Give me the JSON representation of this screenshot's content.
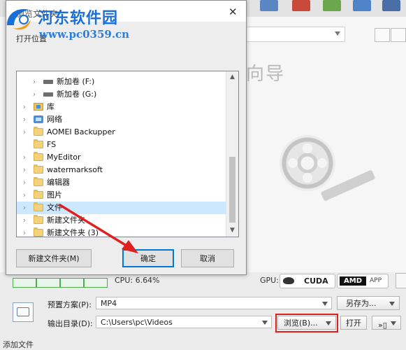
{
  "watermark": {
    "title": "河东软件园",
    "url": "www.pc0359.cn"
  },
  "dialog": {
    "title": "浏览文件夹",
    "prompt": "打开位置",
    "tree": [
      {
        "label": "新加卷 (F:)",
        "icon": "drive-icon",
        "indent": 1,
        "expander": true
      },
      {
        "label": "新加卷 (G:)",
        "icon": "drive-icon",
        "indent": 1,
        "expander": true
      },
      {
        "label": "库",
        "icon": "library-icon",
        "indent": 0,
        "expander": true
      },
      {
        "label": "网络",
        "icon": "network-icon",
        "indent": 0,
        "expander": true
      },
      {
        "label": "AOMEI Backupper",
        "icon": "folder-icon",
        "indent": 0,
        "expander": true
      },
      {
        "label": "FS",
        "icon": "folder-icon",
        "indent": 0,
        "expander": false
      },
      {
        "label": "MyEditor",
        "icon": "folder-icon",
        "indent": 0,
        "expander": true
      },
      {
        "label": "watermarksoft",
        "icon": "folder-icon",
        "indent": 0,
        "expander": true
      },
      {
        "label": "编辑器",
        "icon": "folder-icon",
        "indent": 0,
        "expander": true
      },
      {
        "label": "图片",
        "icon": "folder-icon",
        "indent": 0,
        "expander": true
      },
      {
        "label": "文件",
        "icon": "folder-icon",
        "indent": 0,
        "expander": true,
        "selected": true
      },
      {
        "label": "新建文件夹",
        "icon": "folder-icon",
        "indent": 0,
        "expander": true
      },
      {
        "label": "新建文件夹 (3)",
        "icon": "folder-icon",
        "indent": 0,
        "expander": true
      }
    ],
    "buttons": {
      "new_folder": "新建文件夹(M)",
      "ok": "确定",
      "cancel": "取消"
    }
  },
  "app": {
    "wizard_text": "向导",
    "status": {
      "cpu": "CPU: 6.64%",
      "gpu_label": "GPU:",
      "cuda": "CUDA",
      "amd": "AMD",
      "app": "APP"
    },
    "preset": {
      "label": "预置方案(P):",
      "value": "MP4",
      "save_as": "另存为..."
    },
    "output": {
      "label": "输出目录(D):",
      "value": "C:\\Users\\pc\\Videos",
      "browse": "浏览(B)...",
      "open": "打开"
    },
    "footer": "添加文件"
  },
  "colors": {
    "accent": "#0078d7",
    "selection": "#cce8ff",
    "annotation": "#e02020",
    "watermark": "#1a6fd6"
  }
}
